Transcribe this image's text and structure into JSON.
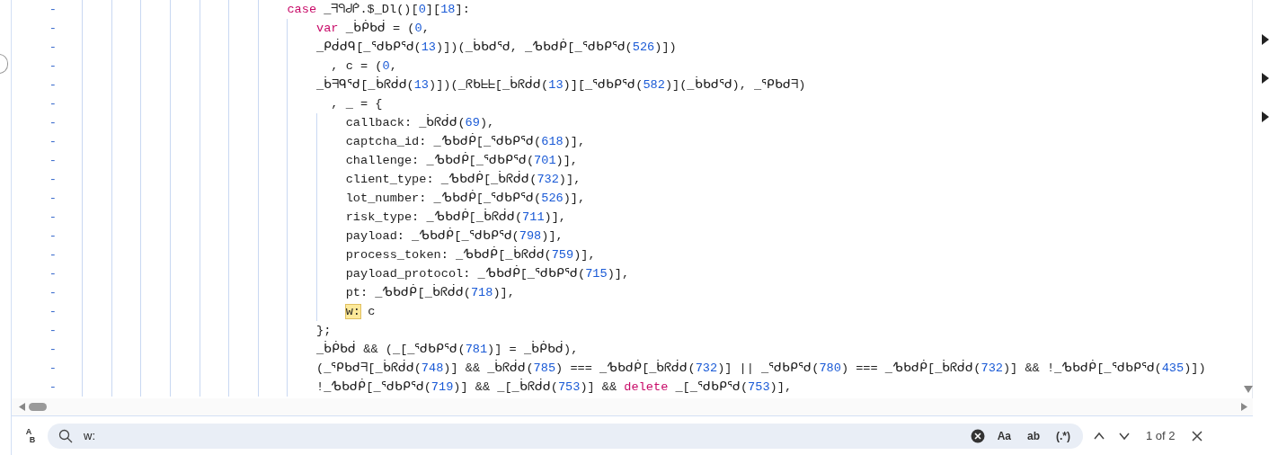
{
  "code_lines": [
    {
      "marker": "-",
      "segments": [
        {
          "text": "                            case",
          "kind": "keyword"
        },
        {
          "text": " _ᖷᑫᑯᑮ.$_Dl()[",
          "kind": "plain"
        },
        {
          "text": "0",
          "kind": "number"
        },
        {
          "text": "][",
          "kind": "plain"
        },
        {
          "text": "18",
          "kind": "number"
        },
        {
          "text": "]:",
          "kind": "plain"
        }
      ]
    },
    {
      "marker": "-",
      "segments": [
        {
          "text": "                                var",
          "kind": "keyword"
        },
        {
          "text": " _ᑳᑮᑲᑰ = (",
          "kind": "plain"
        },
        {
          "text": "0",
          "kind": "number"
        },
        {
          "text": ",",
          "kind": "plain"
        }
      ]
    },
    {
      "marker": "-",
      "segments": [
        {
          "text": "                                _ᑭᑰᑯᑫ[_ᕐᑯᑲᑭᕐᑯ(",
          "kind": "plain"
        },
        {
          "text": "13",
          "kind": "number"
        },
        {
          "text": ")])(_ᑳᑲᑯᕐᑯ, _ᕹᑲᑯᑮ[_ᕐᑯᑲᑭᕐᑯ(",
          "kind": "plain"
        },
        {
          "text": "526",
          "kind": "number"
        },
        {
          "text": ")])",
          "kind": "plain"
        }
      ]
    },
    {
      "marker": "-",
      "segments": [
        {
          "text": "                                  , c = (",
          "kind": "plain"
        },
        {
          "text": "0",
          "kind": "number"
        },
        {
          "text": ",",
          "kind": "plain"
        }
      ]
    },
    {
      "marker": "-",
      "segments": [
        {
          "text": "                                _ᑳᖷᑫᕐᑯ[_ᑳᖇᑰᑯ(",
          "kind": "plain"
        },
        {
          "text": "13",
          "kind": "number"
        },
        {
          "text": ")])(_ᖇᑲᖶᖶ[_ᑳᖇᑰᑯ(",
          "kind": "plain"
        },
        {
          "text": "13",
          "kind": "number"
        },
        {
          "text": ")][_ᕐᑯᑲᑭᕐᑯ(",
          "kind": "plain"
        },
        {
          "text": "582",
          "kind": "number"
        },
        {
          "text": ")](_ᑳᑲᑯᕐᑯ), _ᕿᑲᑯᖷ)",
          "kind": "plain"
        }
      ]
    },
    {
      "marker": "-",
      "segments": [
        {
          "text": "                                  , _ = {",
          "kind": "plain"
        }
      ]
    },
    {
      "marker": "-",
      "segments": [
        {
          "text": "                                    callback: _ᑳᖇᑰᑯ(",
          "kind": "plain"
        },
        {
          "text": "69",
          "kind": "number"
        },
        {
          "text": "),",
          "kind": "plain"
        }
      ]
    },
    {
      "marker": "-",
      "segments": [
        {
          "text": "                                    captcha_id: _ᕹᑲᑯᑮ[_ᕐᑯᑲᑭᕐᑯ(",
          "kind": "plain"
        },
        {
          "text": "618",
          "kind": "number"
        },
        {
          "text": ")],",
          "kind": "plain"
        }
      ]
    },
    {
      "marker": "-",
      "segments": [
        {
          "text": "                                    challenge: _ᕹᑲᑯᑮ[_ᕐᑯᑲᑭᕐᑯ(",
          "kind": "plain"
        },
        {
          "text": "701",
          "kind": "number"
        },
        {
          "text": ")],",
          "kind": "plain"
        }
      ]
    },
    {
      "marker": "-",
      "segments": [
        {
          "text": "                                    client_type: _ᕹᑲᑯᑮ[_ᑳᖇᑰᑯ(",
          "kind": "plain"
        },
        {
          "text": "732",
          "kind": "number"
        },
        {
          "text": ")],",
          "kind": "plain"
        }
      ]
    },
    {
      "marker": "-",
      "segments": [
        {
          "text": "                                    lot_number: _ᕹᑲᑯᑮ[_ᕐᑯᑲᑭᕐᑯ(",
          "kind": "plain"
        },
        {
          "text": "526",
          "kind": "number"
        },
        {
          "text": ")],",
          "kind": "plain"
        }
      ]
    },
    {
      "marker": "-",
      "segments": [
        {
          "text": "                                    risk_type: _ᕹᑲᑯᑮ[_ᑳᖇᑰᑯ(",
          "kind": "plain"
        },
        {
          "text": "711",
          "kind": "number"
        },
        {
          "text": ")],",
          "kind": "plain"
        }
      ]
    },
    {
      "marker": "-",
      "segments": [
        {
          "text": "                                    payload: _ᕹᑲᑯᑮ[_ᕐᑯᑲᑭᕐᑯ(",
          "kind": "plain"
        },
        {
          "text": "798",
          "kind": "number"
        },
        {
          "text": ")],",
          "kind": "plain"
        }
      ]
    },
    {
      "marker": "-",
      "segments": [
        {
          "text": "                                    process_token: _ᕹᑲᑯᑮ[_ᑳᖇᑰᑯ(",
          "kind": "plain"
        },
        {
          "text": "759",
          "kind": "number"
        },
        {
          "text": ")],",
          "kind": "plain"
        }
      ]
    },
    {
      "marker": "-",
      "segments": [
        {
          "text": "                                    payload_protocol: _ᕹᑲᑯᑮ[_ᕐᑯᑲᑭᕐᑯ(",
          "kind": "plain"
        },
        {
          "text": "715",
          "kind": "number"
        },
        {
          "text": ")],",
          "kind": "plain"
        }
      ]
    },
    {
      "marker": "-",
      "segments": [
        {
          "text": "                                    pt: _ᕹᑲᑯᑮ[_ᑳᖇᑰᑯ(",
          "kind": "plain"
        },
        {
          "text": "718",
          "kind": "number"
        },
        {
          "text": ")],",
          "kind": "plain"
        }
      ]
    },
    {
      "marker": "-",
      "segments": [
        {
          "text": "                                    w:",
          "kind": "match"
        },
        {
          "text": " c",
          "kind": "plain"
        }
      ]
    },
    {
      "marker": "-",
      "segments": [
        {
          "text": "                                };",
          "kind": "plain"
        }
      ]
    },
    {
      "marker": "-",
      "segments": [
        {
          "text": "                                _ᑳᑮᑲᑰ && (_[_ᕐᑯᑲᑭᕐᑯ(",
          "kind": "plain"
        },
        {
          "text": "781",
          "kind": "number"
        },
        {
          "text": ")] = _ᑳᑮᑲᑰ),",
          "kind": "plain"
        }
      ]
    },
    {
      "marker": "-",
      "segments": [
        {
          "text": "                                (_ᕿᑲᑯᖷ[_ᑳᖇᑰᑯ(",
          "kind": "plain"
        },
        {
          "text": "748",
          "kind": "number"
        },
        {
          "text": ")] && _ᑳᖇᑰᑯ(",
          "kind": "plain"
        },
        {
          "text": "785",
          "kind": "number"
        },
        {
          "text": ") === _ᕹᑲᑯᑮ[_ᑳᖇᑰᑯ(",
          "kind": "plain"
        },
        {
          "text": "732",
          "kind": "number"
        },
        {
          "text": ")] || _ᕐᑯᑲᑭᕐᑯ(",
          "kind": "plain"
        },
        {
          "text": "780",
          "kind": "number"
        },
        {
          "text": ") === _ᕹᑲᑯᑮ[_ᑳᖇᑰᑯ(",
          "kind": "plain"
        },
        {
          "text": "732",
          "kind": "number"
        },
        {
          "text": ")] && !_ᕹᑲᑯᑮ[_ᕐᑯᑲᑭᕐᑯ(",
          "kind": "plain"
        },
        {
          "text": "435",
          "kind": "number"
        },
        {
          "text": ")])",
          "kind": "plain"
        }
      ]
    },
    {
      "marker": "-",
      "segments": [
        {
          "text": "                                !_ᕹᑲᑯᑮ[_ᕐᑯᑲᑭᕐᑯ(",
          "kind": "plain"
        },
        {
          "text": "719",
          "kind": "number"
        },
        {
          "text": ")] && _[_ᑳᖇᑰᑯ(",
          "kind": "plain"
        },
        {
          "text": "753",
          "kind": "number"
        },
        {
          "text": ")] && ",
          "kind": "plain"
        },
        {
          "text": "delete",
          "kind": "keyword"
        },
        {
          "text": " _[_ᕐᑯᑲᑭᕐᑯ(",
          "kind": "plain"
        },
        {
          "text": "753",
          "kind": "number"
        },
        {
          "text": ")],",
          "kind": "plain"
        }
      ]
    }
  ],
  "find_bar": {
    "replace_toggle": [
      "A",
      "B"
    ],
    "search": {
      "value": "w:"
    },
    "options": [
      {
        "label": "Aa",
        "selected": false
      },
      {
        "label": "ab",
        "selected": false
      },
      {
        "label": "(.*)",
        "selected": false
      }
    ],
    "match_count": "1 of 2"
  }
}
